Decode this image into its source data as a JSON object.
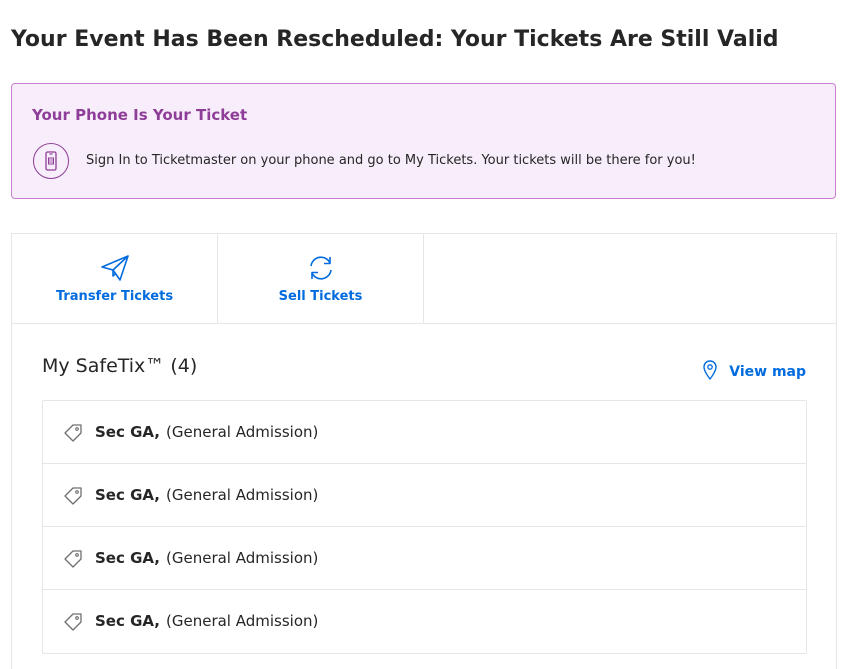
{
  "page": {
    "title": "Your Event Has Been Rescheduled: Your Tickets Are Still Valid"
  },
  "notice": {
    "title": "Your Phone Is Your Ticket",
    "text": "Sign In to Ticketmaster on your phone and go to My Tickets. Your tickets will be there for you!",
    "icon": "phone-icon",
    "accent_color": "#8e3e98",
    "background_color": "#f8edfa"
  },
  "actions": [
    {
      "label": "Transfer Tickets",
      "icon": "paper-plane-icon"
    },
    {
      "label": "Sell Tickets",
      "icon": "refresh-icon"
    }
  ],
  "tickets": {
    "heading": "My SafeTix™",
    "count": "(4)",
    "view_map_label": "View map",
    "link_color": "#026cdf",
    "items": [
      {
        "section": "Sec GA,",
        "admission": "(General Admission)"
      },
      {
        "section": "Sec GA,",
        "admission": "(General Admission)"
      },
      {
        "section": "Sec GA,",
        "admission": "(General Admission)"
      },
      {
        "section": "Sec GA,",
        "admission": "(General Admission)"
      }
    ]
  }
}
